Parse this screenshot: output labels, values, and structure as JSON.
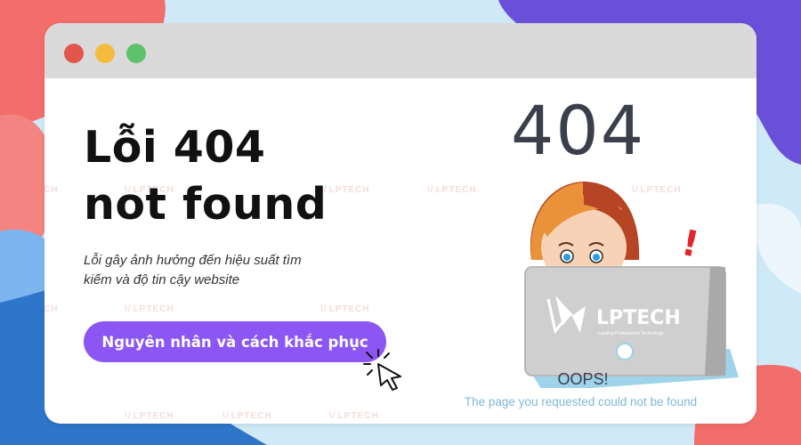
{
  "colors": {
    "background": "#cfe9f7",
    "blob_red": "#f26d6b",
    "blob_purple": "#6a4fd8",
    "blob_blue": "#2f75c9",
    "blob_light_blue": "#7db5f0",
    "titlebar": "#dadada",
    "dot_red": "#e2574c",
    "dot_yellow": "#f3bc3e",
    "dot_green": "#5ec26a",
    "cta_button": "#8b56f4",
    "text_dark": "#111111",
    "accent_text": "#7fb7d8"
  },
  "window": {
    "controls": [
      "close-dot",
      "minimize-dot",
      "maximize-dot"
    ]
  },
  "headline": {
    "line1": "Lỗi 404",
    "line2": "not found"
  },
  "subtitle": {
    "line1": "Lỗi gây ảnh hưởng đến hiệu suất tìm",
    "line2": "kiếm và độ tin cậy website"
  },
  "cta_label": "Nguyên nhân và cách khắc phục",
  "illustration": {
    "code": "404",
    "exclamation": "!",
    "laptop_brand": "LPTECH",
    "laptop_tagline": "Leading Professional Technology",
    "oops": "OOPS!",
    "message": "The page you requested could not be found"
  },
  "watermark_text": "LPTECH",
  "icons": [
    "pointer-cursor-icon",
    "lptech-logo-icon",
    "exclamation-icon"
  ]
}
